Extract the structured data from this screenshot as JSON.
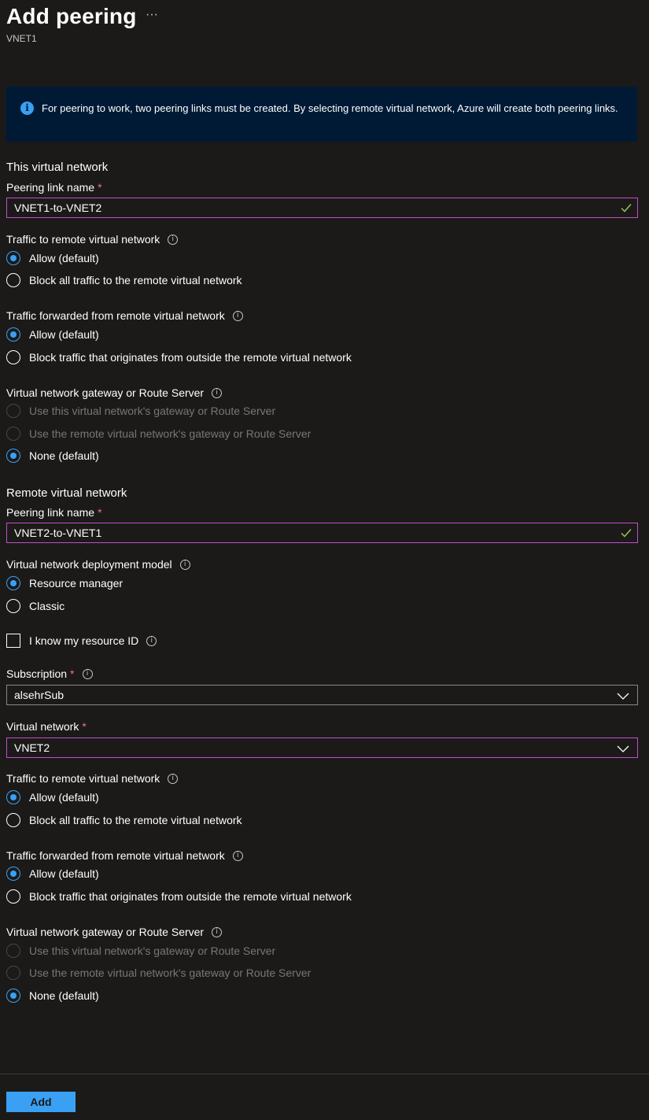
{
  "header": {
    "title": "Add peering",
    "more_icon": "ellipsis-icon",
    "subtitle": "VNET1"
  },
  "info": {
    "icon": "info-icon",
    "text": "For peering to work, two peering links must be created. By selecting remote virtual network, Azure will create both peering links."
  },
  "local": {
    "heading": "This virtual network",
    "peering_label": "Peering link name",
    "peering_value": "VNET1-to-VNET2",
    "traffic_label": "Traffic to remote virtual network",
    "traffic_options": [
      "Allow (default)",
      "Block all traffic to the remote virtual network"
    ],
    "forwarded_label": "Traffic forwarded from remote virtual network",
    "forwarded_options": [
      "Allow (default)",
      "Block traffic that originates from outside the remote virtual network"
    ],
    "gateway_label": "Virtual network gateway or Route Server",
    "gateway_options": [
      "Use this virtual network's gateway or Route Server",
      "Use the remote virtual network's gateway or Route Server",
      "None (default)"
    ]
  },
  "remote": {
    "heading": "Remote virtual network",
    "peering_label": "Peering link name",
    "peering_value": "VNET2-to-VNET1",
    "model_label": "Virtual network deployment model",
    "model_options": [
      "Resource manager",
      "Classic"
    ],
    "resource_id_label": "I know my resource ID",
    "subscription_label": "Subscription",
    "subscription_value": "alsehrSub",
    "vnet_label": "Virtual network",
    "vnet_value": "VNET2",
    "traffic_label": "Traffic to remote virtual network",
    "traffic_options": [
      "Allow (default)",
      "Block all traffic to the remote virtual network"
    ],
    "forwarded_label": "Traffic forwarded from remote virtual network",
    "forwarded_options": [
      "Allow (default)",
      "Block traffic that originates from outside the remote virtual network"
    ],
    "gateway_label": "Virtual network gateway or Route Server",
    "gateway_options": [
      "Use this virtual network's gateway or Route Server",
      "Use the remote virtual network's gateway or Route Server",
      "None (default)"
    ]
  },
  "footer": {
    "add_label": "Add"
  },
  "colors": {
    "background": "#1b1a19",
    "accent": "#3aa0f3",
    "focus_border": "#c04fc9",
    "required": "#f1707b",
    "valid_check": "#92c353",
    "banner": "#001a35"
  }
}
